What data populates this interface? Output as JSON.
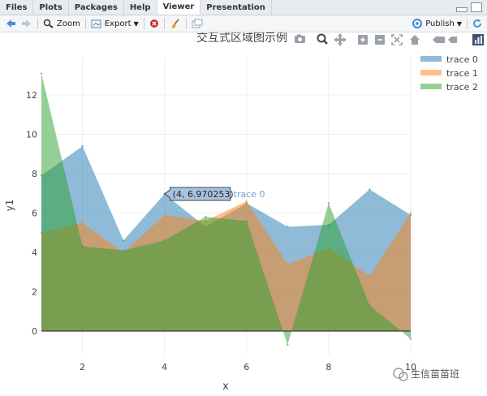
{
  "tabs": [
    "Files",
    "Plots",
    "Packages",
    "Help",
    "Viewer",
    "Presentation"
  ],
  "active_tab": "Viewer",
  "toolbar": {
    "zoom_label": "Zoom",
    "export_label": "Export",
    "publish_label": "Publish"
  },
  "watermark": "生信苗苗班",
  "colors": {
    "trace0": "#1f77b4",
    "trace1": "#ff7f0e",
    "trace2": "#2ca02c"
  },
  "tooltip": {
    "text": "(4, 6.970253)",
    "series": "trace 0"
  },
  "chart_data": {
    "type": "area",
    "title": "交互式区域图示例",
    "xlabel": "x",
    "ylabel": "y1",
    "xlim": [
      1,
      10
    ],
    "ylim": [
      -1.2,
      13.9
    ],
    "x": [
      1,
      2,
      3,
      4,
      5,
      6,
      7,
      8,
      9,
      10
    ],
    "xticks": [
      2,
      4,
      6,
      8,
      10
    ],
    "yticks": [
      0,
      2,
      4,
      6,
      8,
      10,
      12
    ],
    "legend_position": "top-right",
    "series": [
      {
        "name": "trace 0",
        "values": [
          7.9,
          9.4,
          4.6,
          6.970253,
          5.3,
          6.5,
          5.3,
          5.4,
          7.2,
          5.9
        ]
      },
      {
        "name": "trace 1",
        "values": [
          5.0,
          5.5,
          4.0,
          5.9,
          5.6,
          6.6,
          3.4,
          4.2,
          2.8,
          6.0
        ]
      },
      {
        "name": "trace 2",
        "values": [
          13.1,
          4.3,
          4.1,
          4.6,
          5.8,
          5.6,
          -0.7,
          6.5,
          1.3,
          -0.4
        ]
      }
    ]
  }
}
